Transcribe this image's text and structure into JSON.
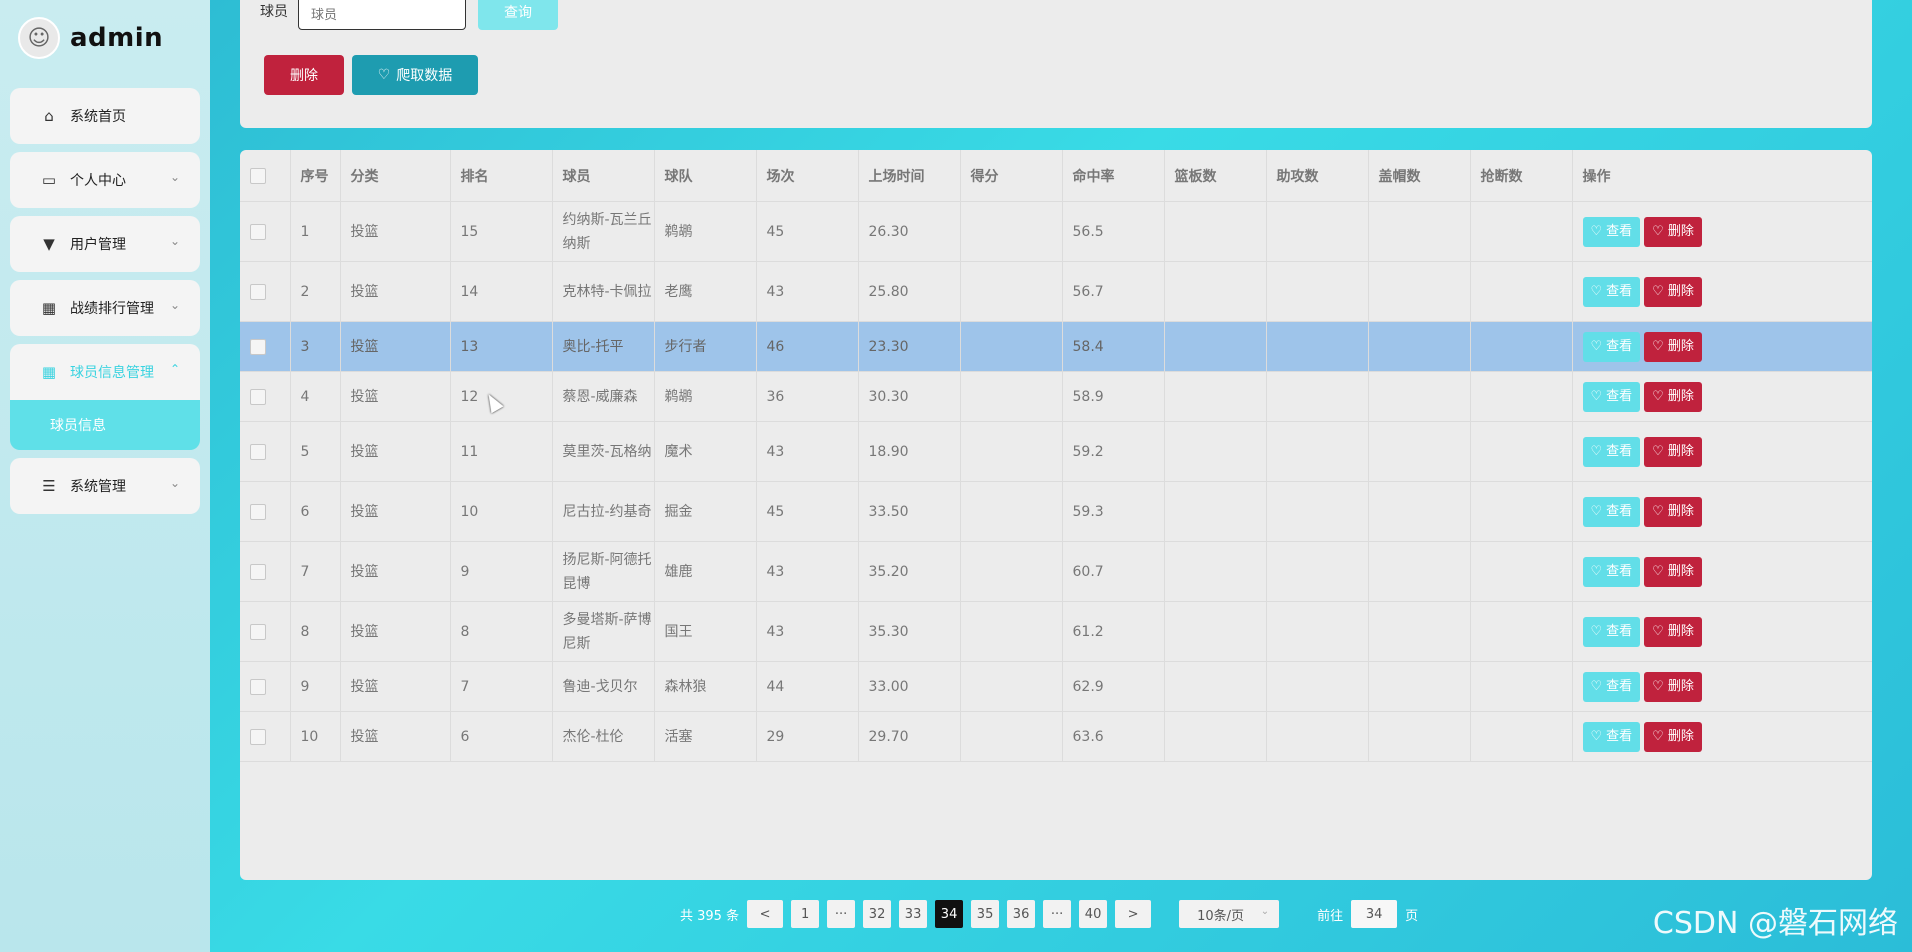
{
  "user": {
    "name": "admin"
  },
  "sidebar": {
    "items": [
      {
        "label": "系统首页",
        "icon": "home-icon"
      },
      {
        "label": "个人中心",
        "icon": "card-icon"
      },
      {
        "label": "用户管理",
        "icon": "user-icon"
      },
      {
        "label": "战绩排行管理",
        "icon": "grid-icon"
      },
      {
        "label": "球员信息管理",
        "icon": "grid-icon"
      },
      {
        "label": "系统管理",
        "icon": "list-icon"
      }
    ],
    "submenu": {
      "label": "球员信息"
    }
  },
  "search": {
    "label": "球员",
    "placeholder": "球员",
    "query_label": "查询"
  },
  "toolbar": {
    "delete_label": "删除",
    "crawl_label": "爬取数据"
  },
  "table": {
    "headers": [
      "序号",
      "分类",
      "排名",
      "球员",
      "球队",
      "场次",
      "上场时间",
      "得分",
      "命中率",
      "篮板数",
      "助攻数",
      "盖帽数",
      "抢断数",
      "操作"
    ],
    "view_label": "查看",
    "delete_label": "删除",
    "rows": [
      {
        "idx": "1",
        "category": "投篮",
        "rank": "15",
        "player": "约纳斯-瓦兰丘纳斯",
        "team": "鹈鹕",
        "games": "45",
        "minutes": "26.30",
        "points": "",
        "fg": "56.5",
        "reb": "",
        "ast": "",
        "blk": "",
        "stl": ""
      },
      {
        "idx": "2",
        "category": "投篮",
        "rank": "14",
        "player": "克林特-卡佩拉",
        "team": "老鹰",
        "games": "43",
        "minutes": "25.80",
        "points": "",
        "fg": "56.7",
        "reb": "",
        "ast": "",
        "blk": "",
        "stl": ""
      },
      {
        "idx": "3",
        "category": "投篮",
        "rank": "13",
        "player": "奥比-托平",
        "team": "步行者",
        "games": "46",
        "minutes": "23.30",
        "points": "",
        "fg": "58.4",
        "reb": "",
        "ast": "",
        "blk": "",
        "stl": ""
      },
      {
        "idx": "4",
        "category": "投篮",
        "rank": "12",
        "player": "蔡恩-威廉森",
        "team": "鹈鹕",
        "games": "36",
        "minutes": "30.30",
        "points": "",
        "fg": "58.9",
        "reb": "",
        "ast": "",
        "blk": "",
        "stl": ""
      },
      {
        "idx": "5",
        "category": "投篮",
        "rank": "11",
        "player": "莫里茨-瓦格纳",
        "team": "魔术",
        "games": "43",
        "minutes": "18.90",
        "points": "",
        "fg": "59.2",
        "reb": "",
        "ast": "",
        "blk": "",
        "stl": ""
      },
      {
        "idx": "6",
        "category": "投篮",
        "rank": "10",
        "player": "尼古拉-约基奇",
        "team": "掘金",
        "games": "45",
        "minutes": "33.50",
        "points": "",
        "fg": "59.3",
        "reb": "",
        "ast": "",
        "blk": "",
        "stl": ""
      },
      {
        "idx": "7",
        "category": "投篮",
        "rank": "9",
        "player": "扬尼斯-阿德托昆博",
        "team": "雄鹿",
        "games": "43",
        "minutes": "35.20",
        "points": "",
        "fg": "60.7",
        "reb": "",
        "ast": "",
        "blk": "",
        "stl": ""
      },
      {
        "idx": "8",
        "category": "投篮",
        "rank": "8",
        "player": "多曼塔斯-萨博尼斯",
        "team": "国王",
        "games": "43",
        "minutes": "35.30",
        "points": "",
        "fg": "61.2",
        "reb": "",
        "ast": "",
        "blk": "",
        "stl": ""
      },
      {
        "idx": "9",
        "category": "投篮",
        "rank": "7",
        "player": "鲁迪-戈贝尔",
        "team": "森林狼",
        "games": "44",
        "minutes": "33.00",
        "points": "",
        "fg": "62.9",
        "reb": "",
        "ast": "",
        "blk": "",
        "stl": ""
      },
      {
        "idx": "10",
        "category": "投篮",
        "rank": "6",
        "player": "杰伦-杜伦",
        "team": "活塞",
        "games": "29",
        "minutes": "29.70",
        "points": "",
        "fg": "63.6",
        "reb": "",
        "ast": "",
        "blk": "",
        "stl": ""
      }
    ]
  },
  "pagination": {
    "total_text": "共 395 条",
    "prev": "<",
    "next": ">",
    "pages": [
      "1",
      "···",
      "32",
      "33",
      "34",
      "35",
      "36",
      "···",
      "40"
    ],
    "current": "34",
    "page_size": "10条/页",
    "goto_prefix": "前往",
    "goto_value": "34",
    "goto_suffix": "页"
  },
  "watermark": "CSDN @磐石网络"
}
